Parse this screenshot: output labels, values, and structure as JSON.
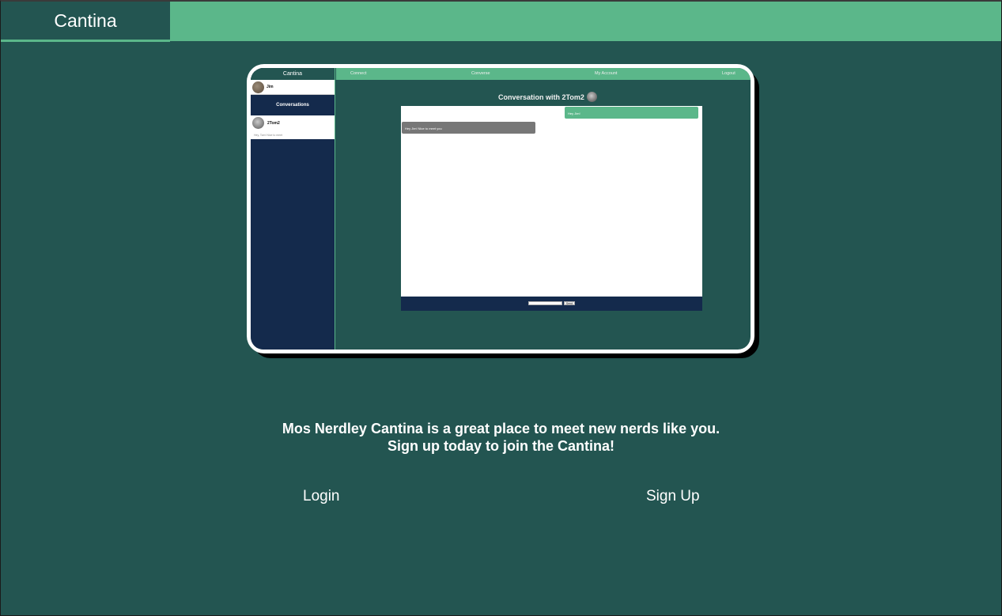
{
  "header": {
    "brand": "Cantina"
  },
  "preview": {
    "brand": "Cantina",
    "user_name": "Jim",
    "conversations_label": "Conversations",
    "conversation_item": {
      "name": "2Tom2",
      "preview": "Hey, Tom! Nice to meet"
    },
    "nav": [
      "Connect",
      "Converse",
      "My Account",
      "Logout"
    ],
    "chat_title": "Conversation with 2Tom2",
    "messages": {
      "sent": "Hey Jim!",
      "received": "Hey Jim! Nice to meet you"
    },
    "send_label": "Send"
  },
  "main": {
    "tagline_line1": "Mos Nerdley Cantina is a great place to meet new nerds like you.",
    "tagline_line2": "Sign up today to join the Cantina!",
    "login_label": "Login",
    "signup_label": "Sign Up"
  },
  "colors": {
    "background": "#235551",
    "accent": "#5bb78a",
    "sidebar": "#142a4c"
  }
}
